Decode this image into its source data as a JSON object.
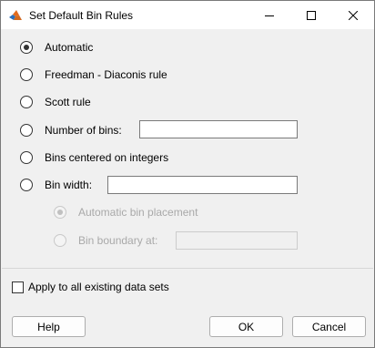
{
  "window": {
    "title": "Set Default Bin Rules",
    "app_icon": "matlab-icon",
    "controls": [
      "minimize-icon",
      "maximize-icon",
      "close-icon"
    ]
  },
  "options": {
    "automatic": {
      "label": "Automatic",
      "selected": true
    },
    "freedman": {
      "label": "Freedman - Diaconis rule",
      "selected": false
    },
    "scott": {
      "label": "Scott rule",
      "selected": false
    },
    "num_bins": {
      "label": "Number of bins:",
      "selected": false,
      "value": ""
    },
    "integers": {
      "label": "Bins centered on integers",
      "selected": false
    },
    "bin_width": {
      "label": "Bin width:",
      "selected": false,
      "value": ""
    }
  },
  "placement": {
    "automatic": {
      "label": "Automatic bin placement",
      "selected": true,
      "enabled": false
    },
    "boundary": {
      "label": "Bin boundary at:",
      "selected": false,
      "enabled": false,
      "value": ""
    }
  },
  "apply_all": {
    "label": "Apply to all existing data sets",
    "checked": false
  },
  "buttons": {
    "help": "Help",
    "ok": "OK",
    "cancel": "Cancel"
  }
}
